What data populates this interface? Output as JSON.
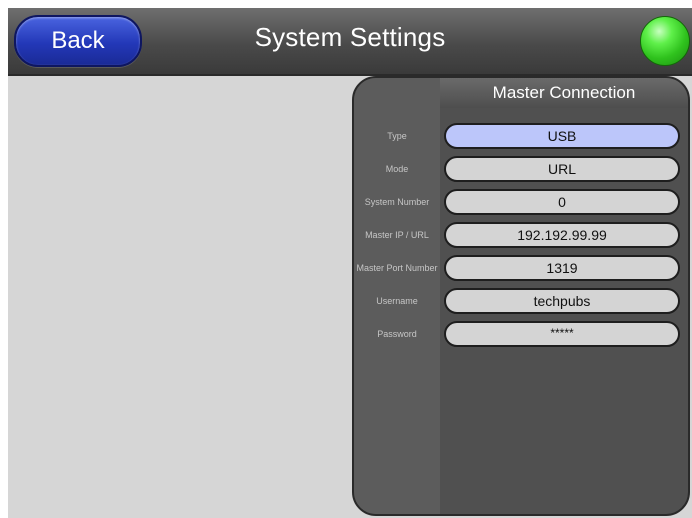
{
  "header": {
    "back_label": "Back",
    "title": "System Settings",
    "status_color": "#3ad42a"
  },
  "panel": {
    "title": "Master Connection",
    "rows": [
      {
        "label": "Type",
        "value": "USB",
        "selected": true
      },
      {
        "label": "Mode",
        "value": "URL",
        "selected": false
      },
      {
        "label": "System Number",
        "value": "0",
        "selected": false
      },
      {
        "label": "Master IP / URL",
        "value": "192.192.99.99",
        "selected": false
      },
      {
        "label": "Master Port Number",
        "value": "1319",
        "selected": false
      },
      {
        "label": "Username",
        "value": "techpubs",
        "selected": false
      },
      {
        "label": "Password",
        "value": "*****",
        "selected": false
      }
    ]
  },
  "colors": {
    "accent_blue": "#2338b8",
    "selected_field": "#bcc6fa",
    "panel_bg": "#505050",
    "content_bg": "#d6d6d6"
  }
}
